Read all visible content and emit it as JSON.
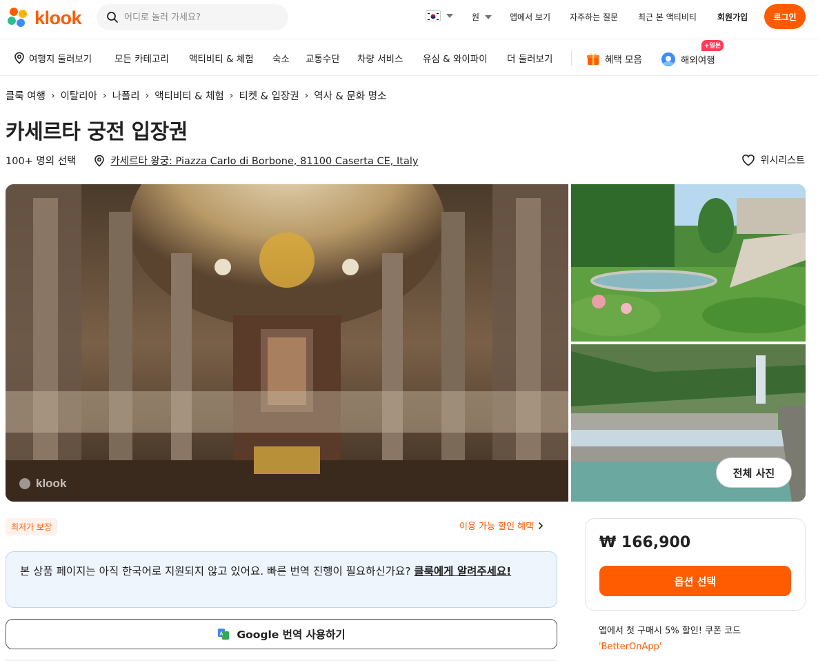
{
  "brand": {
    "name": "klook"
  },
  "search": {
    "placeholder": "어디로 놀러 가세요?"
  },
  "header": {
    "currency": "원",
    "links": [
      "앱에서 보기",
      "자주하는 질문",
      "최근 본 액티비티",
      "회원가입"
    ],
    "login": "로그인"
  },
  "categories": {
    "items": [
      "여행지 둘러보기",
      "모든 카테고리",
      "액티비티 & 체험",
      "숙소",
      "교통수단",
      "차량 서비스",
      "유심 & 와이파이",
      "더 둘러보기"
    ],
    "benefits": "혜택 모음",
    "overseas": "해외여행",
    "overseas_badge": "+일본"
  },
  "breadcrumb": [
    "클룩 여행",
    "이탈리아",
    "나폴리",
    "액티비티 & 체험",
    "티켓 & 입장권",
    "역사 & 문화 명소"
  ],
  "product": {
    "title": "카세르타 궁전 입장권",
    "popularity": "100+ 명의 선택",
    "address": "카세르타 왕궁: Piazza Carlo di Borbone, 81100 Caserta CE, Italy",
    "wishlist": "위시리스트"
  },
  "gallery": {
    "watermark": "klook",
    "all_photos": "전체 사진"
  },
  "deal": {
    "best_price": "최저가 보장",
    "discounts": "이용 가능 할인 혜택"
  },
  "notice": {
    "text": "본 상품 페이지는 아직 한국어로 지원되지 않고 있어요. 빠른 번역 진행이 필요하신가요? ",
    "link": "클룩에게 알려주세요!"
  },
  "translate": {
    "label": "Google 번역 사용하기"
  },
  "booking": {
    "price": "₩ 166,900",
    "select_option": "옵션 선택",
    "promo_text": "앱에서 첫 구매시 5% 할인! 쿠폰 코드",
    "promo_code": "'BetterOnApp'"
  },
  "colors": {
    "accent": "#ff5b00",
    "notice_bg": "#eef5fd",
    "badge_red": "#ff3d5a"
  }
}
